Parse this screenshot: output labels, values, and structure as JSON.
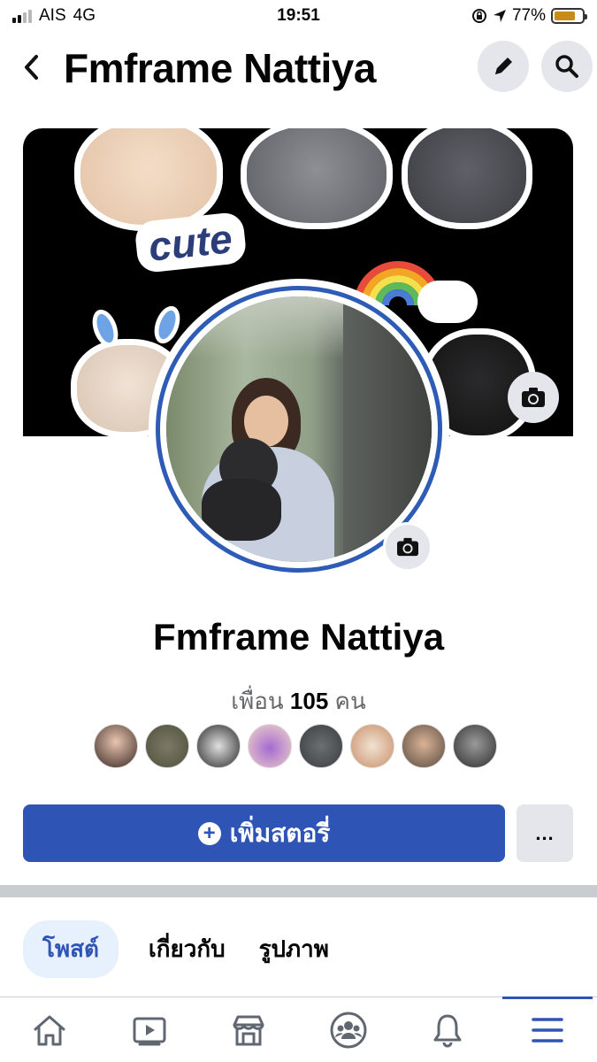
{
  "status_bar": {
    "carrier": "AIS",
    "network": "4G",
    "time": "19:51",
    "battery": "77%",
    "battery_level": 0.77
  },
  "header": {
    "title": "Fmframe Nattiya"
  },
  "cover_sticker_text": "cute",
  "profile": {
    "name": "Fmframe Nattiya",
    "friends_prefix": "เพื่อน",
    "friends_count": "105",
    "friends_suffix": "คน"
  },
  "actions": {
    "add_story_label": "เพิ่มสตอรี่",
    "more_label": "..."
  },
  "tabs": [
    {
      "label": "โพสต์",
      "active": true
    },
    {
      "label": "เกี่ยวกับ",
      "active": false
    },
    {
      "label": "รูปภาพ",
      "active": false
    }
  ],
  "bottom_nav": [
    {
      "icon": "home-icon"
    },
    {
      "icon": "video-icon"
    },
    {
      "icon": "marketplace-icon"
    },
    {
      "icon": "groups-icon"
    },
    {
      "icon": "bell-icon"
    },
    {
      "icon": "menu-icon",
      "active": true
    }
  ],
  "colors": {
    "accent": "#2e55b5",
    "button_gray": "#e4e6eb",
    "battery": "#c98a1a"
  }
}
